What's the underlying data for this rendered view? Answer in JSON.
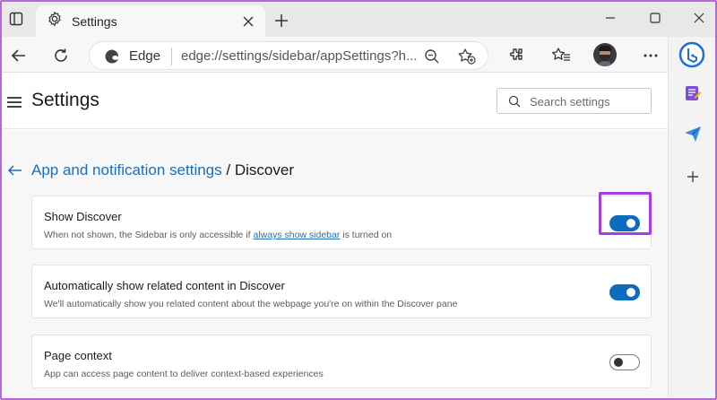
{
  "browser": {
    "tab": {
      "title": "Settings"
    },
    "address": {
      "site_label": "Edge",
      "url": "edge://settings/sidebar/appSettings?h..."
    }
  },
  "settings": {
    "title": "Settings",
    "search": {
      "placeholder": "Search settings"
    }
  },
  "breadcrumb": {
    "parent": "App and notification settings",
    "separator": "/",
    "current": "Discover"
  },
  "cards": [
    {
      "title": "Show Discover",
      "desc_prefix": "When not shown, the Sidebar is only accessible if ",
      "desc_link": "always show sidebar",
      "desc_suffix": " is turned on",
      "enabled": true
    },
    {
      "title": "Automatically show related content in Discover",
      "desc": "We'll automatically show you related content about the webpage you're on within the Discover pane",
      "enabled": true
    },
    {
      "title": "Page context",
      "desc": "App can access page content to deliver context-based experiences",
      "enabled": false
    }
  ],
  "colors": {
    "accent": "#0f6cbd",
    "link": "#1f6fb5",
    "highlight": "#a63ee0"
  },
  "icons": [
    "tab-actions-icon",
    "gear-icon",
    "close-icon",
    "plus-icon",
    "minimize-icon",
    "maximize-icon",
    "back-icon",
    "refresh-icon",
    "edge-icon",
    "zoom-out-icon",
    "add-favorite-icon",
    "extensions-icon",
    "favorites-icon",
    "more-icon",
    "bing-icon",
    "collections-icon",
    "send-icon",
    "search-icon",
    "hamburger-icon",
    "back-arrow-icon"
  ]
}
